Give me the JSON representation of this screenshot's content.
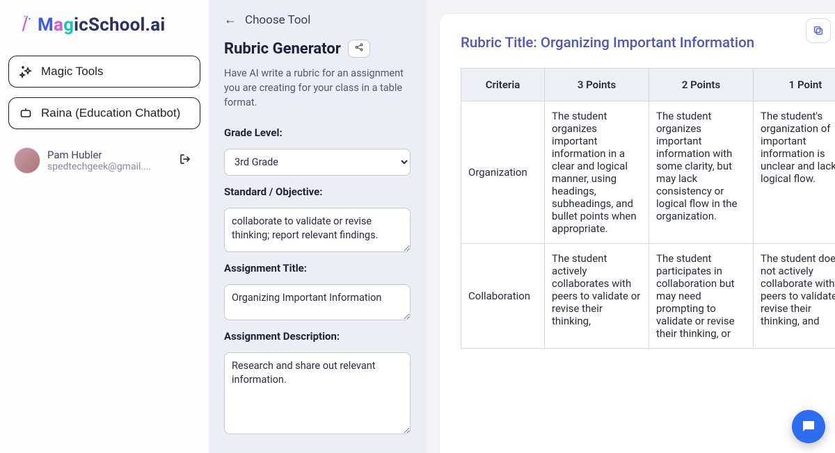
{
  "brand": {
    "logo_parts": {
      "m": "M",
      "a": "a",
      "g": "g",
      "rest": "icSchool.ai"
    }
  },
  "sidebar": {
    "magic_tools": "Magic Tools",
    "raina": "Raina (Education Chatbot)",
    "user": {
      "name": "Pam Hubler",
      "email": "spedtechgeek@gmail...."
    }
  },
  "form": {
    "back_label": "Choose Tool",
    "tool_title": "Rubric Generator",
    "tool_desc": "Have AI write a rubric for an assignment you are creating for your class in a table format.",
    "labels": {
      "grade": "Grade Level:",
      "objective": "Standard / Objective:",
      "title": "Assignment Title:",
      "description": "Assignment Description:"
    },
    "values": {
      "grade": "3rd Grade",
      "objective": "collaborate to validate or revise thinking; report relevant findings.",
      "title": "Organizing Important Information",
      "description": "Research and share out relevant information."
    }
  },
  "output": {
    "rubric_title_prefix": "Rubric Title: ",
    "rubric_title": "Organizing Important Information",
    "columns": [
      "Criteria",
      "3 Points",
      "2 Points",
      "1 Point"
    ],
    "rows": [
      {
        "criteria": "Organization",
        "cells": [
          "The student organizes important information in a clear and logical manner, using headings, subheadings, and bullet points when appropriate.",
          "The student organizes important information with some clarity, but may lack consistency or logical flow in the organization.",
          "The student's organization of important information is unclear and lacks logical flow."
        ]
      },
      {
        "criteria": "Collaboration",
        "cells": [
          "The student actively collaborates with peers to validate or revise their thinking,",
          "The student participates in collaboration but may need prompting to validate or revise their thinking, or",
          "The student does not actively collaborate with peers to validate or revise their thinking, and"
        ]
      }
    ]
  }
}
